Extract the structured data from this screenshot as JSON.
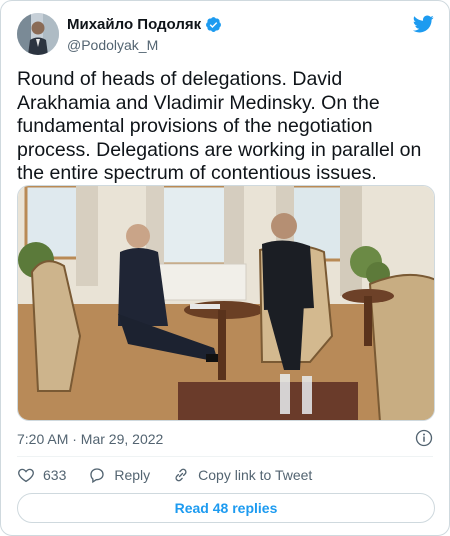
{
  "author": {
    "display_name": "Михайло Подоляк",
    "handle": "@Podolyak_M",
    "avatar_icon": "avatar",
    "verified_icon": "verified-badge-icon"
  },
  "tweet": {
    "text": "Round of heads of delegations. David Arakhamia and Vladimir Medinsky. On the fundamental provisions of the negotiation process. Delegations are working in parallel on the entire spectrum of contentious issues.",
    "timestamp": "7:20 AM · Mar 29, 2022"
  },
  "actions": {
    "like_count": "633",
    "reply_label": "Reply",
    "copy_link_label": "Copy link to Tweet"
  },
  "replies_button": "Read 48 replies",
  "colors": {
    "accent": "#1d9bf0",
    "like": "#536471",
    "muted": "#536471"
  }
}
